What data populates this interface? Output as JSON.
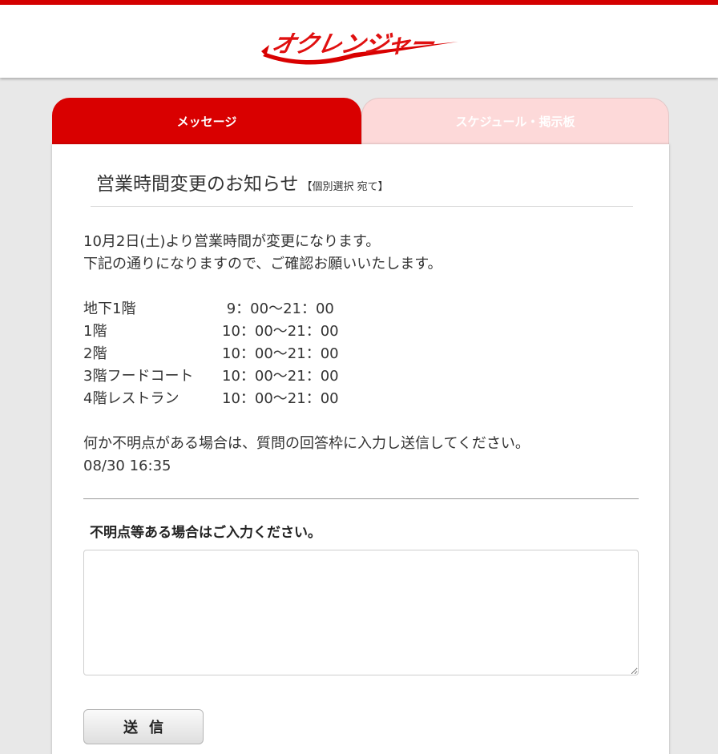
{
  "header": {
    "logo_text": "オクレンジャー",
    "brand_color": "#d90000"
  },
  "tabs": [
    {
      "label": "メッセージ",
      "active": true
    },
    {
      "label": "スケジュール・掲示板",
      "active": false
    }
  ],
  "message": {
    "title": "営業時間変更のお知らせ",
    "recipient_tag": "【個別選択 宛て】",
    "intro_lines": [
      "10月2日(土)より営業時間が変更になります。",
      "下記の通りになりますので、ご確認お願いいたします。"
    ],
    "floors": [
      {
        "name": "地下1階",
        "hours": " 9：00～21：00"
      },
      {
        "name": "1階",
        "hours": "10：00～21：00"
      },
      {
        "name": "2階",
        "hours": "10：00～21：00"
      },
      {
        "name": "3階フードコート",
        "hours": "10：00～21：00"
      },
      {
        "name": "4階レストラン",
        "hours": "10：00～21：00"
      }
    ],
    "closing_line": "何か不明点がある場合は、質問の回答枠に入力し送信してください。",
    "timestamp": "08/30 16:35"
  },
  "reply": {
    "label": "不明点等ある場合はご入力ください。",
    "value": "",
    "submit_label": "送信"
  }
}
